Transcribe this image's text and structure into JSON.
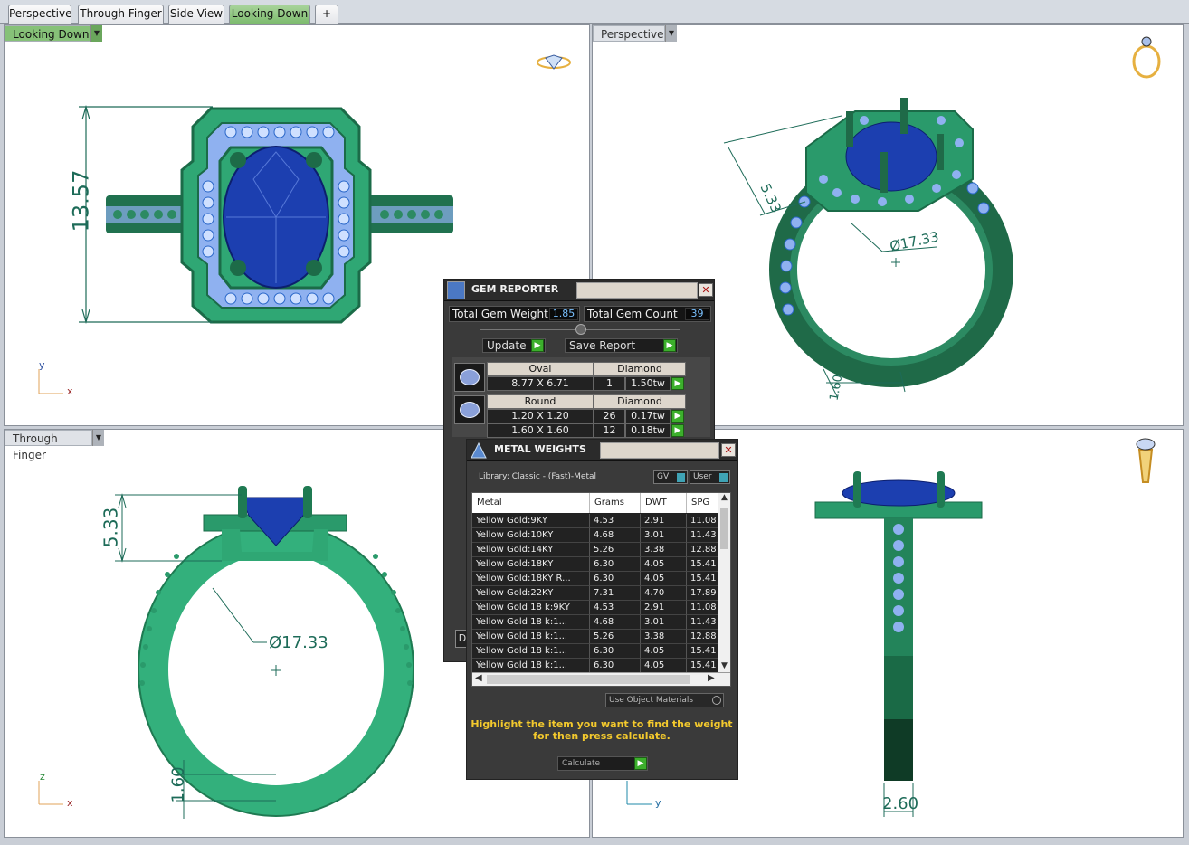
{
  "tabs": [
    {
      "label": "Perspective"
    },
    {
      "label": "Through Finger"
    },
    {
      "label": "Side View"
    },
    {
      "label": "Looking Down"
    },
    {
      "label": "+"
    }
  ],
  "viewports": {
    "top_left": {
      "title": "Looking Down",
      "dim_height": "13.57",
      "axis_y": "y",
      "axis_x": "x"
    },
    "top_right": {
      "title": "Perspective",
      "dim_a": "5.33",
      "dim_diam": "Ø17.33",
      "dim_b": "1.60"
    },
    "bottom_left": {
      "title": "Through Finger",
      "dim_top": "5.33",
      "dim_diam": "Ø17.33",
      "dim_bottom": "1.60",
      "axis_z": "z",
      "axis_x": "x"
    },
    "bottom_right": {
      "dim_width": "2.60",
      "axis_y": "y"
    }
  },
  "gem_reporter": {
    "title": "GEM REPORTER",
    "weight_label": "Total Gem Weight",
    "weight_value": "1.85",
    "count_label": "Total Gem Count",
    "count_value": "39",
    "update_label": "Update",
    "save_label": "Save Report",
    "groups": [
      {
        "shape": "Oval",
        "material": "Diamond",
        "rows": [
          {
            "size": "8.77 X 6.71",
            "count": "1",
            "weight": "1.50tw"
          }
        ]
      },
      {
        "shape": "Round",
        "material": "Diamond",
        "rows": [
          {
            "size": "1.20 X 1.20",
            "count": "26",
            "weight": "0.17tw"
          },
          {
            "size": "1.60 X 1.60",
            "count": "12",
            "weight": "0.18tw"
          }
        ]
      }
    ],
    "bottom_partial": "D"
  },
  "metal_weights": {
    "title": "METAL WEIGHTS",
    "library": "Library: Classic - (Fast)-Metal",
    "gv_label": "GV",
    "user_label": "User",
    "columns": [
      "Metal",
      "Grams",
      "DWT",
      "SPG"
    ],
    "rows": [
      [
        "Yellow Gold:9KY",
        "4.53",
        "2.91",
        "11.08"
      ],
      [
        "Yellow Gold:10KY",
        "4.68",
        "3.01",
        "11.43"
      ],
      [
        "Yellow Gold:14KY",
        "5.26",
        "3.38",
        "12.88"
      ],
      [
        "Yellow Gold:18KY",
        "6.30",
        "4.05",
        "15.41"
      ],
      [
        "Yellow Gold:18KY R...",
        "6.30",
        "4.05",
        "15.41"
      ],
      [
        "Yellow Gold:22KY",
        "7.31",
        "4.70",
        "17.89"
      ],
      [
        "Yellow Gold 18 k:9KY",
        "4.53",
        "2.91",
        "11.08"
      ],
      [
        "Yellow Gold 18 k:1...",
        "4.68",
        "3.01",
        "11.43"
      ],
      [
        "Yellow Gold 18 k:1...",
        "5.26",
        "3.38",
        "12.88"
      ],
      [
        "Yellow Gold 18 k:1...",
        "6.30",
        "4.05",
        "15.41"
      ],
      [
        "Yellow Gold 18 k:1...",
        "6.30",
        "4.05",
        "15.41"
      ]
    ],
    "use_object_materials": "Use Object Materials",
    "instruction_line1": "Highlight the item you want to find the weight",
    "instruction_line2": "for then press calculate.",
    "calculate_label": "Calculate"
  },
  "colors": {
    "ring": "#2a9a6b",
    "ring_dark": "#1f5f44",
    "gem": "#1c3fb0",
    "pave": "#8fb1f0",
    "dimension": "#1d6b58"
  }
}
